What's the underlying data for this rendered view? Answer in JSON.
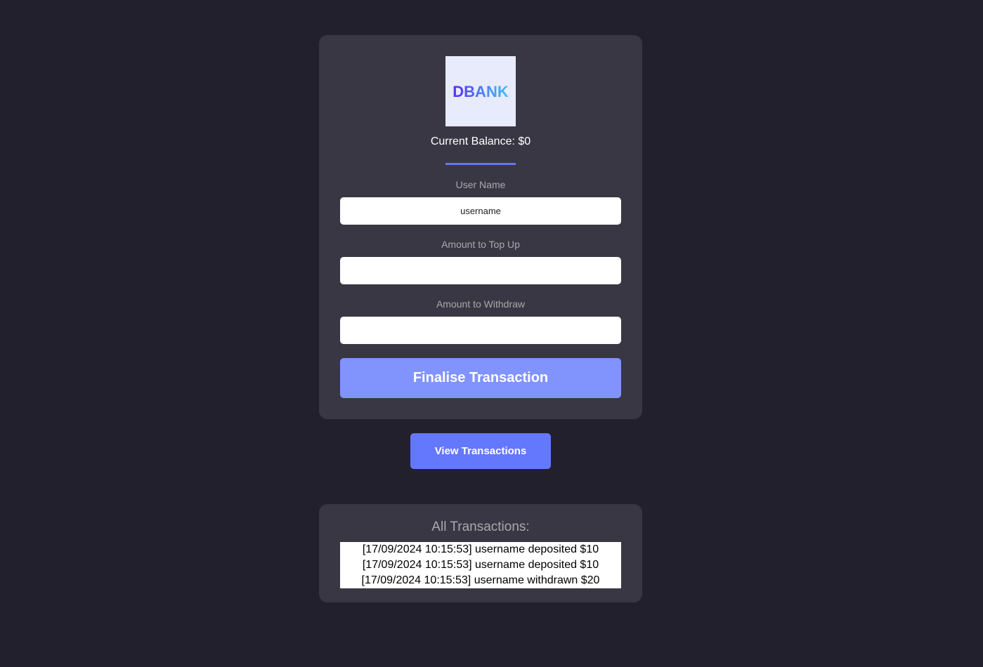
{
  "logo": {
    "text": "DBANK"
  },
  "balance": {
    "label": "Current Balance:",
    "value": "$0"
  },
  "form": {
    "username_label": "User Name",
    "username_value": "username",
    "topup_label": "Amount to Top Up",
    "topup_value": "",
    "withdraw_label": "Amount to Withdraw",
    "withdraw_value": "",
    "submit_label": "Finalise Transaction"
  },
  "view_button_label": "View Transactions",
  "transactions": {
    "title": "All Transactions:",
    "items": [
      "[17/09/2024 10:15:53] username deposited $10",
      "[17/09/2024 10:15:53] username deposited $10",
      "[17/09/2024 10:15:53] username withdrawn $20"
    ]
  },
  "colors": {
    "background": "#22202d",
    "card": "#393743",
    "accent": "#6478fd",
    "finalise_button": "#8193fd"
  }
}
